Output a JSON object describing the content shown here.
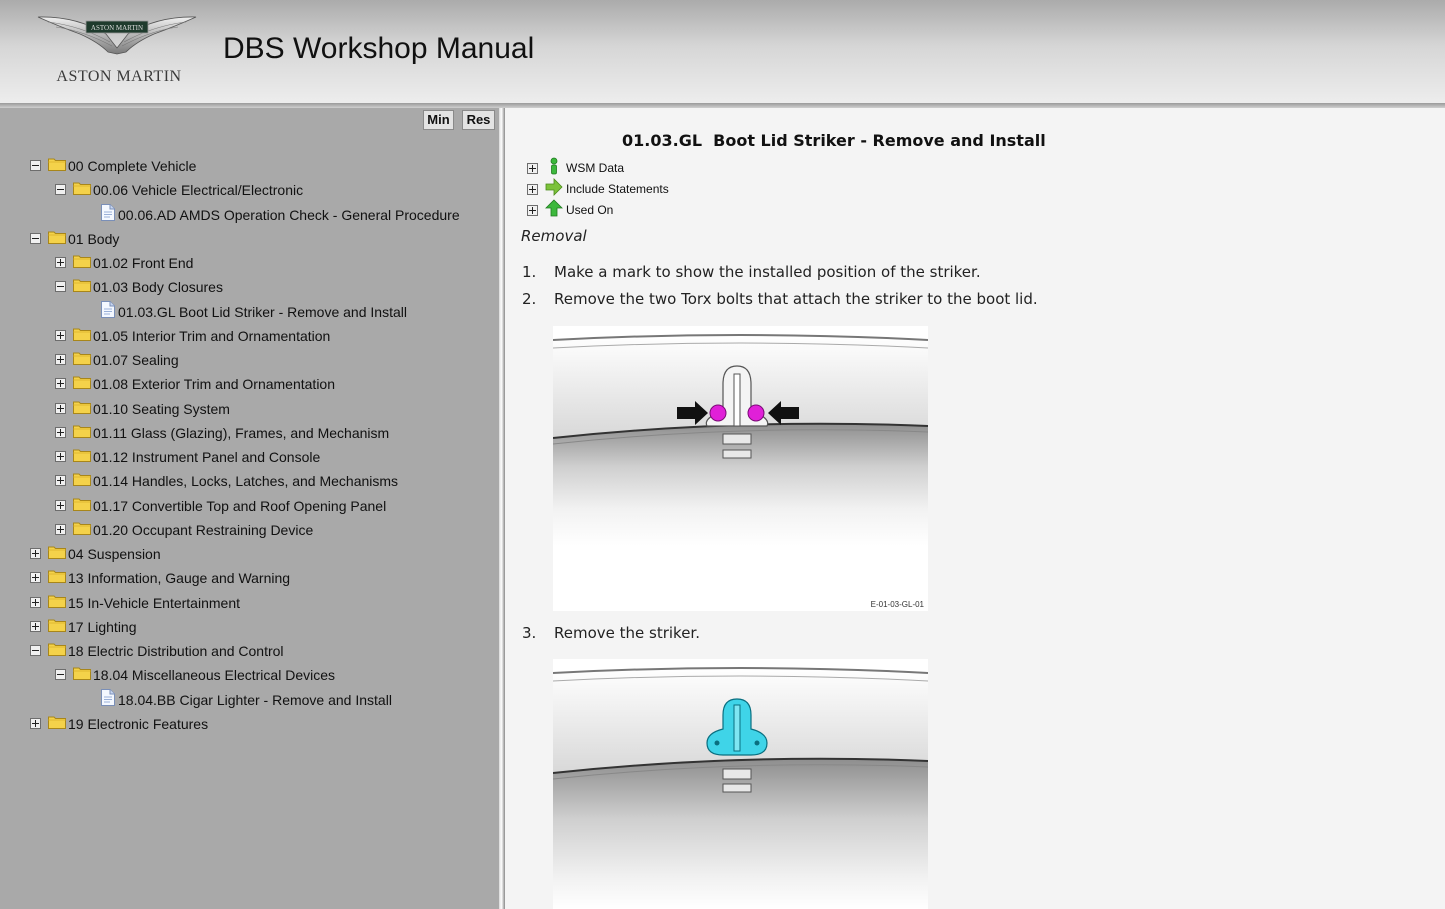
{
  "header": {
    "logo_text": "ASTON MARTIN",
    "title": "DBS Workshop Manual"
  },
  "sidebar": {
    "min_label": "Min",
    "res_label": "Res",
    "tree": [
      {
        "label": "00 Complete Vehicle",
        "type": "folder",
        "expanded": true
      },
      {
        "label": "00.06 Vehicle Electrical/Electronic",
        "type": "folder",
        "expanded": true
      },
      {
        "label": "00.06.AD AMDS Operation Check - General Procedure",
        "type": "doc"
      },
      {
        "label": "01 Body",
        "type": "folder",
        "expanded": true
      },
      {
        "label": "01.02 Front End",
        "type": "folder",
        "expanded": false
      },
      {
        "label": "01.03 Body Closures",
        "type": "folder",
        "expanded": true
      },
      {
        "label": "01.03.GL Boot Lid Striker - Remove and Install",
        "type": "doc"
      },
      {
        "label": "01.05 Interior Trim and Ornamentation",
        "type": "folder",
        "expanded": false
      },
      {
        "label": "01.07 Sealing",
        "type": "folder",
        "expanded": false
      },
      {
        "label": "01.08 Exterior Trim and Ornamentation",
        "type": "folder",
        "expanded": false
      },
      {
        "label": "01.10 Seating System",
        "type": "folder",
        "expanded": false
      },
      {
        "label": "01.11 Glass (Glazing), Frames, and Mechanism",
        "type": "folder",
        "expanded": false
      },
      {
        "label": "01.12 Instrument Panel and Console",
        "type": "folder",
        "expanded": false
      },
      {
        "label": "01.14 Handles, Locks, Latches, and Mechanisms",
        "type": "folder",
        "expanded": false
      },
      {
        "label": "01.17 Convertible Top and Roof Opening Panel",
        "type": "folder",
        "expanded": false
      },
      {
        "label": "01.20 Occupant Restraining Device",
        "type": "folder",
        "expanded": false
      },
      {
        "label": "04 Suspension",
        "type": "folder",
        "expanded": false
      },
      {
        "label": "13 Information, Gauge and Warning",
        "type": "folder",
        "expanded": false
      },
      {
        "label": "15 In-Vehicle Entertainment",
        "type": "folder",
        "expanded": false
      },
      {
        "label": "17 Lighting",
        "type": "folder",
        "expanded": false
      },
      {
        "label": "18 Electric Distribution and Control",
        "type": "folder",
        "expanded": true
      },
      {
        "label": "18.04 Miscellaneous Electrical Devices",
        "type": "folder",
        "expanded": true
      },
      {
        "label": "18.04.BB Cigar Lighter - Remove and Install",
        "type": "doc"
      },
      {
        "label": "19 Electronic Features",
        "type": "folder",
        "expanded": false
      }
    ]
  },
  "content": {
    "title": "01.03.GL  Boot Lid Striker - Remove and Install",
    "meta": [
      {
        "label": "WSM Data",
        "icon": "info-icon"
      },
      {
        "label": "Include Statements",
        "icon": "arrow-right-icon"
      },
      {
        "label": "Used On",
        "icon": "arrow-up-icon"
      }
    ],
    "section": "Removal",
    "steps": [
      {
        "num": "1.",
        "text": "Make a mark to show the installed position of the striker."
      },
      {
        "num": "2.",
        "text": "Remove the two Torx bolts that attach the striker to the boot lid."
      },
      {
        "num": "3.",
        "text": "Remove the striker."
      }
    ],
    "figure1_caption": "E-01-03-GL-01",
    "colors": {
      "accent": "#e020d8",
      "striker": "#3fd4e8"
    }
  }
}
